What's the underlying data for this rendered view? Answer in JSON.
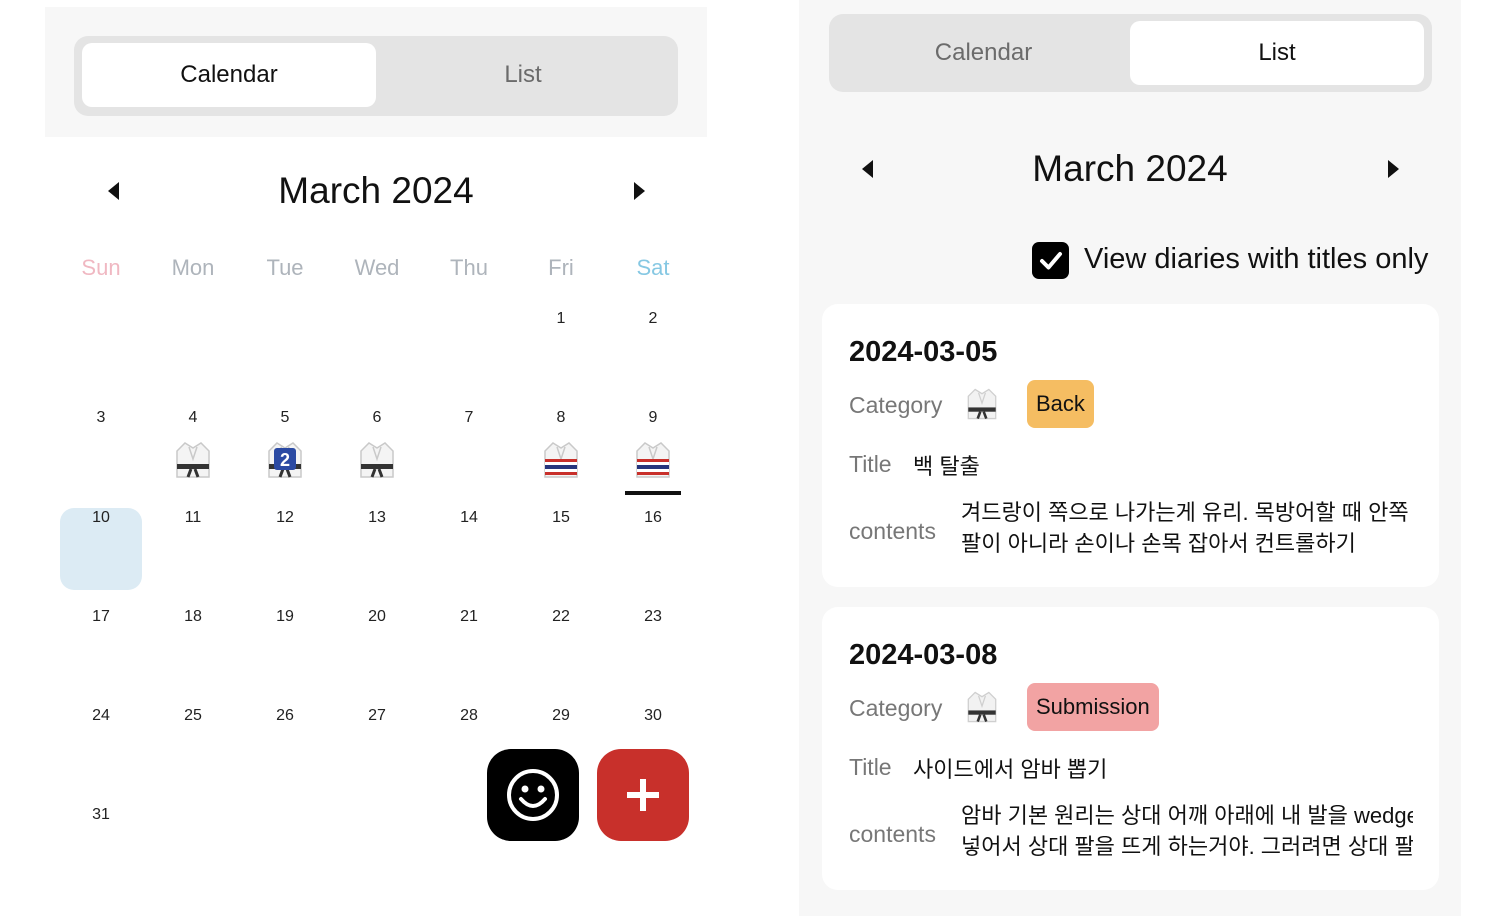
{
  "left": {
    "tabs": [
      {
        "label": "Calendar",
        "active": true
      },
      {
        "label": "List",
        "active": false
      }
    ],
    "month_title": "March 2024",
    "weekdays": [
      "Sun",
      "Mon",
      "Tue",
      "Wed",
      "Thu",
      "Fri",
      "Sat"
    ],
    "weeks": [
      [
        "",
        "",
        "",
        "",
        "",
        "1",
        "2"
      ],
      [
        "3",
        "4",
        "5",
        "6",
        "7",
        "8",
        "9"
      ],
      [
        "10",
        "11",
        "12",
        "13",
        "14",
        "15",
        "16"
      ],
      [
        "17",
        "18",
        "19",
        "20",
        "21",
        "22",
        "23"
      ],
      [
        "24",
        "25",
        "26",
        "27",
        "28",
        "29",
        "30"
      ],
      [
        "31",
        "",
        "",
        "",
        "",
        "",
        ""
      ]
    ],
    "today": "10",
    "selected": "9",
    "day_icons": {
      "4": {
        "icon": "gi-black-belt-icon"
      },
      "5": {
        "icon": "gi-blue-belt-icon",
        "badge": "2"
      },
      "6": {
        "icon": "gi-black-belt-icon"
      },
      "8": {
        "icon": "gi-thai-flag-icon"
      },
      "9": {
        "icon": "gi-thai-flag-icon"
      }
    },
    "fab": {
      "emoji_icon": "smiley-icon",
      "add_icon": "plus-icon"
    }
  },
  "right": {
    "tabs": [
      {
        "label": "Calendar",
        "active": false
      },
      {
        "label": "List",
        "active": true
      }
    ],
    "month_title": "March 2024",
    "filter_label": "View diaries with titles only",
    "filter_checked": true,
    "entries": [
      {
        "date": "2024-03-05",
        "category_label": "Category",
        "category": "Back",
        "category_color": "#f5bd62",
        "title_label": "Title",
        "title": "백 탈출",
        "contents_label": "contents",
        "contents_line1": "겨드랑이 쪽으로 나가는게 유리. 목방어할 때 안쪽",
        "contents_line2": "팔이 아니라 손이나 손목 잡아서 컨트롤하기"
      },
      {
        "date": "2024-03-08",
        "category_label": "Category",
        "category": "Submission",
        "category_color": "#f2a3a3",
        "title_label": "Title",
        "title": "사이드에서 암바 뽑기",
        "contents_label": "contents",
        "contents_line1": "암바 기본 원리는 상대 어깨 아래에 내 발을 wedge",
        "contents_line2": "넣어서 상대 팔을 뜨게 하는거야. 그러려면 상대 팔"
      }
    ]
  },
  "colors": {
    "accent_red": "#c8302b",
    "today_bg": "#dcebf4",
    "sun": "#f0b8c2",
    "sat": "#86c8e3"
  }
}
